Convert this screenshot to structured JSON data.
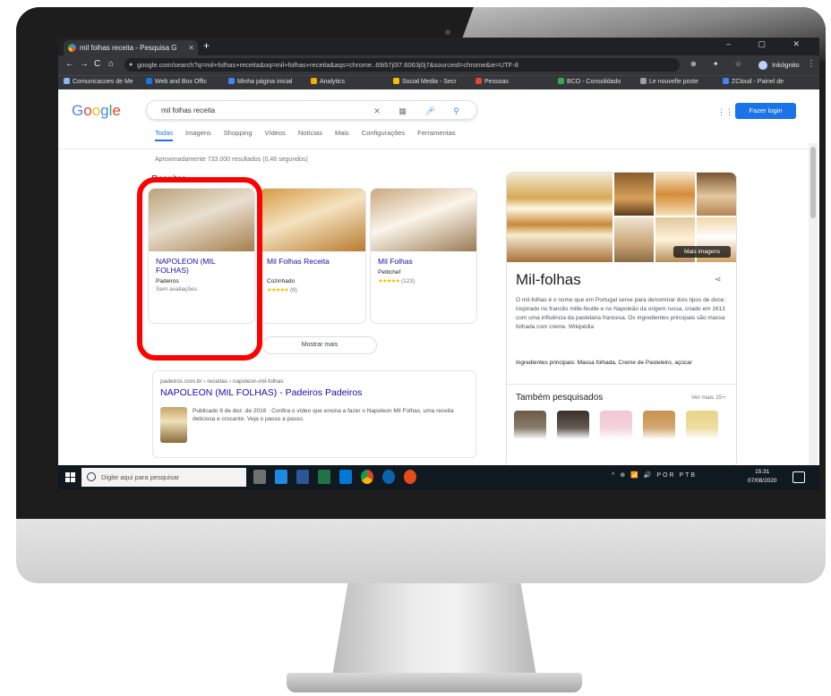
{
  "browser": {
    "tab_title": "mil folhas receita - Pesquisa G",
    "tab_close": "✕",
    "new_tab": "+",
    "window_controls": "–  ▢  ✕",
    "nav": {
      "back": "←",
      "forward": "→",
      "reload": "C",
      "home": "⌂"
    },
    "url": "google.com/search?q=mil+folhas+receita&oq=mil+folhas+receita&aqs=chrome..69i57j0l7.6063j0j7&sourceid=chrome&ie=UTF-8",
    "toolbar_icons": "⊕ ✦ ☆",
    "profile": "Inkógnito",
    "menu": "⋮",
    "bookmarks": [
      {
        "label": "Comunicacoes de Me",
        "color": "#8ab4f8"
      },
      {
        "label": "Web and Box Offic",
        "color": "#1a73e8"
      },
      {
        "label": "Minha página inicial",
        "color": "#4285f4"
      },
      {
        "label": "Analytics",
        "color": "#f9ab00"
      },
      {
        "label": "Social Media - Secr",
        "color": "#fbbc04"
      },
      {
        "label": "Pessoas",
        "color": "#ea4335"
      },
      {
        "label": "BCO - Consolidado",
        "color": "#34a853"
      },
      {
        "label": "Le nouvelle poste",
        "color": "#9aa0a6"
      },
      {
        "label": "ZCloud - Painel de",
        "color": "#4285f4"
      }
    ]
  },
  "google": {
    "logo_letters": [
      {
        "ch": "G",
        "color": "#4285f4"
      },
      {
        "ch": "o",
        "color": "#ea4335"
      },
      {
        "ch": "o",
        "color": "#fbbc05"
      },
      {
        "ch": "g",
        "color": "#4285f4"
      },
      {
        "ch": "l",
        "color": "#34a853"
      },
      {
        "ch": "e",
        "color": "#ea4335"
      }
    ],
    "query": "mil folhas receita",
    "search_icons": {
      "clear": "✕",
      "keyboard": "▦",
      "mic": "🎤",
      "search": "🔍"
    },
    "apps_icon": "⋮⋮⋮",
    "signin_label": "Fazer login",
    "tabs": [
      "Todas",
      "Imagens",
      "Shopping",
      "Vídeos",
      "Notícias",
      "Mais",
      "Configurações",
      "Ferramentas"
    ],
    "stats": "Aproximadamente 733.000 resultados (0,46 segundos)",
    "recipes_title": "Receitas",
    "recipes": [
      {
        "title": "NAPOLEON (MIL FOLHAS)",
        "source": "Padeiros",
        "meta": "Sem avaliações",
        "stars": "",
        "colors": [
          "#b9a27a",
          "#e9dfcf",
          "#a37f4c"
        ]
      },
      {
        "title": "Mil Folhas Receita",
        "source": "Cozinhado",
        "meta": "(8)",
        "stars": "★★★★★",
        "colors": [
          "#d79a44",
          "#f4e3c0",
          "#b97a2f"
        ]
      },
      {
        "title": "Mil Folhas",
        "source": "Petitchef",
        "meta": "(123)",
        "stars": "★★★★★",
        "colors": [
          "#caa77f",
          "#fbf5ea",
          "#9a7a54"
        ]
      }
    ],
    "recipes_more_chevron": "⌄",
    "recipes_more": "Mostrar mais",
    "result": {
      "url": "padeiros.com.br › receitas › napoleon-mil-folhas",
      "title": "NAPOLEON (MIL FOLHAS) - Padeiros Padeiros",
      "snippet": "Publicado 6 de dez. de 2016 · Confira o vídeo que ensina a fazer o Napoleon Mil Folhas, uma receita deliciosa e crocante. Veja o passo a passo."
    },
    "knowledge_panel": {
      "more_images": "Mais imagens",
      "title": "Mil-folhas",
      "share_icon": "⋖",
      "description": "O mil-folhas é o nome que em Portugal serve para denominar dois tipos de doce: inspirado no francês mille-feuille e no Napoleão da origem russa, criado em 1613 com uma influência da pastelaria francesa. Os ingredientes principais são massa folhada com creme. Wikipédia",
      "ingredients": "Ingredientes principais: Massa folhada, Creme de Pasteleiro, açúcar",
      "also_searched": "Também pesquisados",
      "also_more": "Ver mais 15+",
      "thumb_colors": [
        "#6b5b45",
        "#3b3027",
        "#f2c7d4",
        "#c7924e",
        "#e8d58a"
      ]
    }
  },
  "taskbar": {
    "search_placeholder": "Digite aqui para pesquisar",
    "tray": "^ ⊕ 📶 🔊 POR PTB",
    "time": "15:31",
    "date": "07/08/2020",
    "app_colors": [
      "#6f6f6f",
      "#1e88e5",
      "#2b5797",
      "#217346",
      "#0078d7",
      "#db4437",
      "#0a64ad",
      "#e64a19"
    ]
  }
}
